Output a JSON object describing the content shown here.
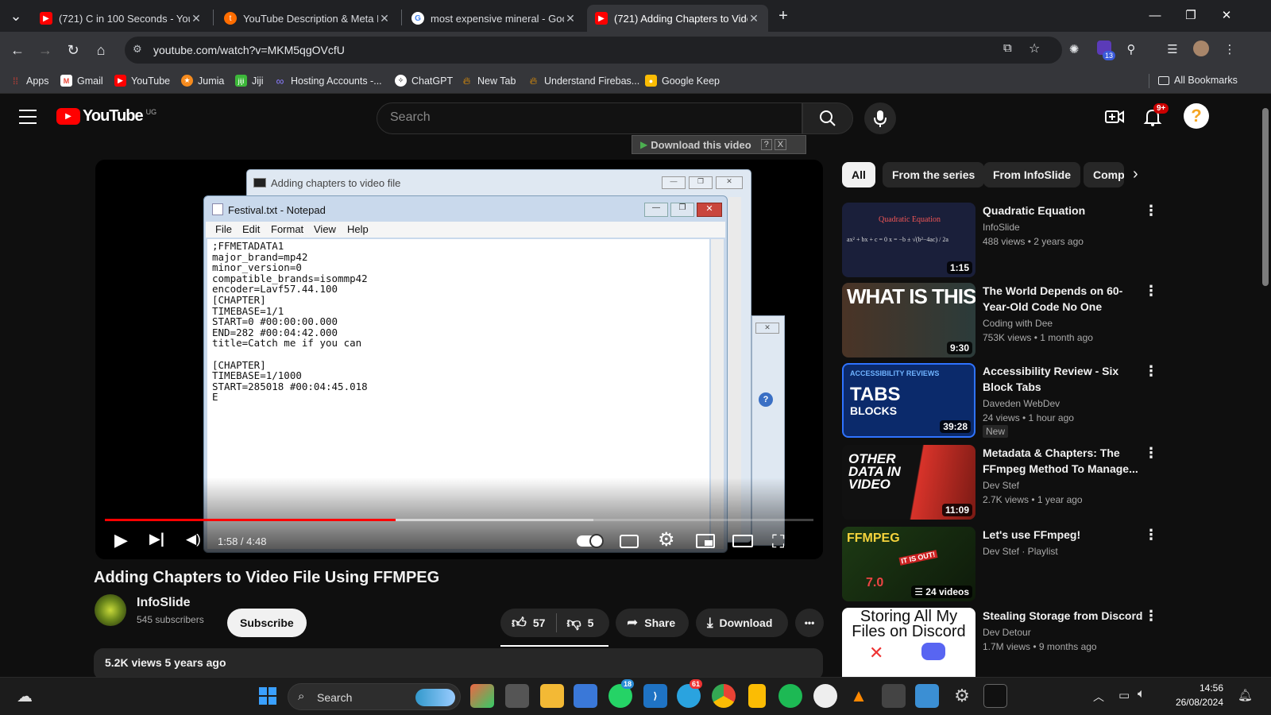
{
  "browser": {
    "tabs": [
      {
        "title": "(721) C in 100 Seconds - YouTube",
        "favicon": "youtube-icon",
        "active": false
      },
      {
        "title": "YouTube Description & Meta Data",
        "favicon": "tool-icon",
        "active": false
      },
      {
        "title": "most expensive mineral - Google Search",
        "favicon": "google-icon",
        "active": false
      },
      {
        "title": "(721) Adding Chapters to Video File",
        "favicon": "youtube-icon",
        "active": true
      }
    ],
    "new_tab": "+",
    "url": "youtube.com/watch?v=MKM5qgOVcfU",
    "extension_badge": "13",
    "bookmarks": [
      {
        "label": "Apps",
        "icon": "apps-grid-icon"
      },
      {
        "label": "Gmail",
        "icon": "gmail-icon"
      },
      {
        "label": "YouTube",
        "icon": "youtube-icon"
      },
      {
        "label": "Jumia",
        "icon": "jumia-icon"
      },
      {
        "label": "Jiji",
        "icon": "jiji-icon"
      },
      {
        "label": "Hosting Accounts -...",
        "icon": "hosting-icon"
      },
      {
        "label": "ChatGPT",
        "icon": "chatgpt-icon"
      },
      {
        "label": "New Tab",
        "icon": "firebase-icon"
      },
      {
        "label": "Understand Firebas...",
        "icon": "firebase-icon"
      },
      {
        "label": "Google Keep",
        "icon": "keep-icon"
      }
    ],
    "all_bookmarks": "All Bookmarks"
  },
  "youtube": {
    "logo_text": "YouTube",
    "country": "UG",
    "search_placeholder": "Search",
    "notifications_badge": "9+",
    "download_helper": "Download this video",
    "download_helper_q": "?",
    "download_helper_x": "X",
    "video": {
      "title": "Adding Chapters to Video File Using FFMPEG",
      "time": "1:58 / 4:48",
      "progress": 0.41,
      "buffered": 0.69,
      "cmd_window_title": "Adding chapters to video file",
      "notepad_title": "Festival.txt - Notepad",
      "notepad_menu": [
        "File",
        "Edit",
        "Format",
        "View",
        "Help"
      ],
      "notepad_lines": [
        ";FFMETADATA1",
        "major_brand=mp42",
        "minor_version=0",
        "compatible_brands=isommp42",
        "encoder=Lavf57.44.100",
        "[CHAPTER]",
        "TIMEBASE=1/1",
        "START=0 #00:00:00.000",
        "END=282 #00:04:42.000",
        "title=Catch me if you can",
        "",
        "[CHAPTER]",
        "TIMEBASE=1/1000",
        "START=285018 #00:04:45.018",
        "E"
      ]
    },
    "channel": {
      "name": "InfoSlide",
      "subscribers": "545 subscribers",
      "subscribe": "Subscribe"
    },
    "actions": {
      "likes": "57",
      "dislikes": "5",
      "share": "Share",
      "download": "Download",
      "more": "•••"
    },
    "description_peek": "5.2K views  5 years ago",
    "chips": [
      "All",
      "From the series",
      "From InfoSlide",
      "Comp"
    ],
    "recommendations": [
      {
        "title": "Quadratic Equation",
        "channel": "InfoSlide",
        "meta": "488 views  • 2 years ago",
        "duration": "1:15",
        "thumb_text": "Quadratic Equation",
        "thumb_sub": "ax² + bx + c = 0    x = −b ± √(b²−4ac) / 2a",
        "new": ""
      },
      {
        "title": "The World Depends on 60-Year-Old Code No One Knows...",
        "channel": "Coding with Dee",
        "meta": "753K views  • 1 month ago",
        "duration": "9:30",
        "thumb_text": "WHAT IS THIS?",
        "thumb_sub": "",
        "new": ""
      },
      {
        "title": "Accessibility Review - Six Block Tabs",
        "channel": "Daveden WebDev",
        "meta": "24 views  • 1 hour ago",
        "duration": "39:28",
        "thumb_text": "TABS",
        "thumb_sub": "BLOCKS",
        "thumb_top": "ACCESSIBILITY REVIEWS",
        "new": "New"
      },
      {
        "title": "Metadata & Chapters: The FFmpeg Method To Manage...",
        "channel": "Dev Stef",
        "meta": "2.7K views  • 1 year ago",
        "duration": "11:09",
        "thumb_text": "OTHER DATA IN VIDEO",
        "thumb_sub": "",
        "new": ""
      },
      {
        "title": "Let's use FFmpeg!",
        "channel": "Dev Stef · Playlist",
        "meta": "",
        "duration": "24 videos",
        "thumb_text": "FFMPEG",
        "thumb_sub": "IT IS OUT!",
        "thumb_num": "7.0",
        "new": ""
      },
      {
        "title": "Stealing Storage from Discord",
        "channel": "Dev Detour",
        "meta": "1.7M views  • 9 months ago",
        "duration": "",
        "thumb_text": "Storing All My Files on Discord",
        "thumb_sub": "",
        "new": ""
      }
    ]
  },
  "taskbar": {
    "search": "Search",
    "whatsapp_badge": "18",
    "telegram_badge": "61",
    "time": "14:56",
    "date": "26/08/2024"
  },
  "colors": {
    "yt_red": "#ff0000",
    "bg": "#0f0f0f",
    "chrome_dark": "#202124",
    "chrome_mid": "#35363a"
  }
}
